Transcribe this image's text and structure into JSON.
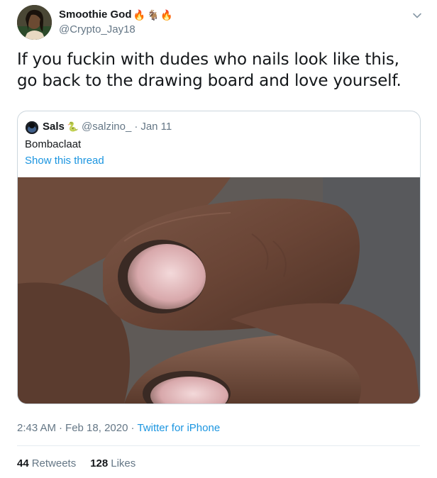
{
  "author": {
    "display_name": "Smoothie God",
    "name_emojis": [
      "🔥",
      "🐐",
      "🔥"
    ],
    "handle": "@Crypto_Jay18"
  },
  "tweet": {
    "text": "If you fuckin with dudes who nails look like this, go back to the drawing board and love yourself."
  },
  "quoted": {
    "name": "Sals",
    "name_emoji": "🐍",
    "handle": "@salzino_",
    "separator": "·",
    "date": "Jan 11",
    "text": "Bombaclaat",
    "show_thread": "Show this thread"
  },
  "meta": {
    "time": "2:43 AM",
    "sep1": "·",
    "date": "Feb 18, 2020",
    "sep2": "·",
    "source": "Twitter for iPhone"
  },
  "stats": {
    "retweets_count": "44",
    "retweets_label": "Retweets",
    "likes_count": "128",
    "likes_label": "Likes"
  },
  "colors": {
    "link": "#1b95e0",
    "secondary": "#657786",
    "border": "#ccd6dd"
  },
  "icons": [
    "chevron-down-icon"
  ]
}
